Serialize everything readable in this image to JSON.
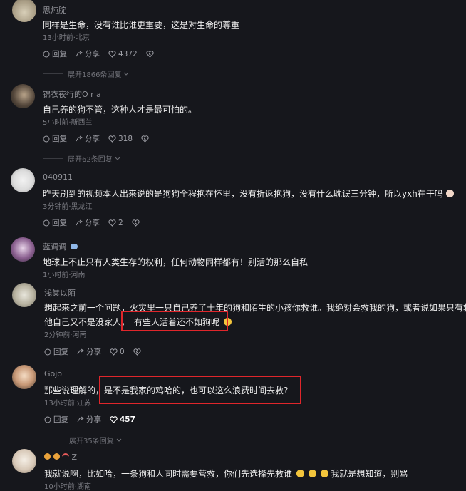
{
  "comments": [
    {
      "user": "思炖腚",
      "text": "同样是生命，没有谁比谁更重要，这是对生命的尊重",
      "meta": "13小时前·北京",
      "reply": "回复",
      "share": "分享",
      "likes": "4372",
      "expand": "展开1866条回复"
    },
    {
      "user": "锦衣夜行的O r a",
      "text": "自己养的狗不管，这种人才是最可怕的。",
      "meta": "5小时前·新西兰",
      "reply": "回复",
      "share": "分享",
      "likes": "318",
      "expand": "展开62条回复"
    },
    {
      "user": "040911",
      "text": "昨天刷到的视频本人出来说的是狗狗全程抱在怀里，没有折返抱狗，没有什么耽误三分钟，所以yxh在干吗",
      "meta": "3分钟前·黑龙江",
      "reply": "回复",
      "share": "分享",
      "likes": "2"
    },
    {
      "user": "蓝调调",
      "text": "地球上不止只有人类生存的权利，任何动物同样都有！别活的那么自私",
      "meta": "1小时前·河南"
    },
    {
      "user": "浅棠以陌",
      "text1": "想起来之前一个问题，火灾里一只自己养了十年的狗和陌生的小孩你救谁。我绝对会救我的狗，或者说如果只有救小孩",
      "text2a": "他自己又不是没家人，",
      "text2b": "有些人活着还不如狗呢",
      "meta": "2分钟前·河南",
      "reply": "回复",
      "share": "分享",
      "likes": "0"
    },
    {
      "user": "Gojo",
      "text1": "那些说理解的，",
      "text2": "是不是我家的鸡哈的，也可以这么浪费时间去救?",
      "meta": "13小时前·江苏",
      "reply": "回复",
      "share": "分享",
      "likes": "457",
      "expand": "展开35条回复"
    },
    {
      "user": "Z",
      "text": "我就说啊，比如哈，一条狗和人同时需要营救，你们先选择先救谁",
      "text_tail": "我就是想知道，别骂",
      "meta": "10小时前·湖南"
    }
  ]
}
